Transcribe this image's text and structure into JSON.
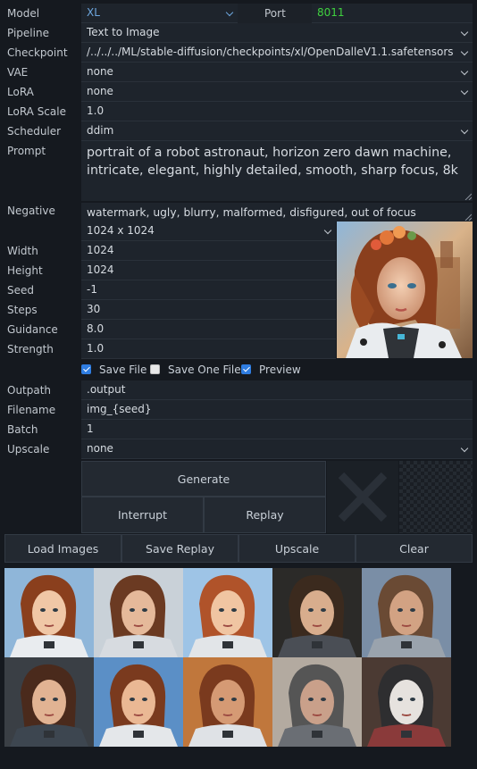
{
  "labels": {
    "model": "Model",
    "port": "Port",
    "pipeline": "Pipeline",
    "checkpoint": "Checkpoint",
    "vae": "VAE",
    "lora": "LoRA",
    "lora_scale": "LoRA Scale",
    "scheduler": "Scheduler",
    "prompt": "Prompt",
    "negative": "Negative",
    "width": "Width",
    "height": "Height",
    "seed": "Seed",
    "steps": "Steps",
    "guidance": "Guidance",
    "strength": "Strength",
    "outpath": "Outpath",
    "filename": "Filename",
    "batch": "Batch",
    "upscale": "Upscale"
  },
  "values": {
    "model": "XL",
    "port": "8011",
    "pipeline": "Text to Image",
    "checkpoint": "/../../../ML/stable-diffusion/checkpoints/xl/OpenDalleV1.1.safetensors",
    "vae": "none",
    "lora": "none",
    "lora_scale": "1.0",
    "scheduler": "ddim",
    "prompt": "portrait of a robot astronaut, horizon zero dawn machine, intricate, elegant, highly detailed, smooth, sharp focus, 8k",
    "negative": "watermark, ugly, blurry, malformed, disfigured, out of focus",
    "size": "1024 x 1024",
    "width": "1024",
    "height": "1024",
    "seed": "-1",
    "steps": "30",
    "guidance": "8.0",
    "strength": "1.0",
    "outpath": ".output",
    "filename": "img_{seed}",
    "batch": "1",
    "upscale": "none"
  },
  "checkboxes": {
    "save_file": {
      "label": "Save File",
      "checked": true
    },
    "save_one_file": {
      "label": "Save One File",
      "checked": false
    },
    "preview": {
      "label": "Preview",
      "checked": true
    }
  },
  "buttons": {
    "generate": "Generate",
    "interrupt": "Interrupt",
    "replay": "Replay",
    "load_images": "Load Images",
    "save_replay": "Save Replay",
    "upscale": "Upscale",
    "clear": "Clear"
  },
  "gallery": {
    "count": 10
  },
  "colors": {
    "accent": "#2f7de1",
    "port_value": "#3fd13f",
    "model_value": "#6ea8e0",
    "background": "#15191f"
  }
}
